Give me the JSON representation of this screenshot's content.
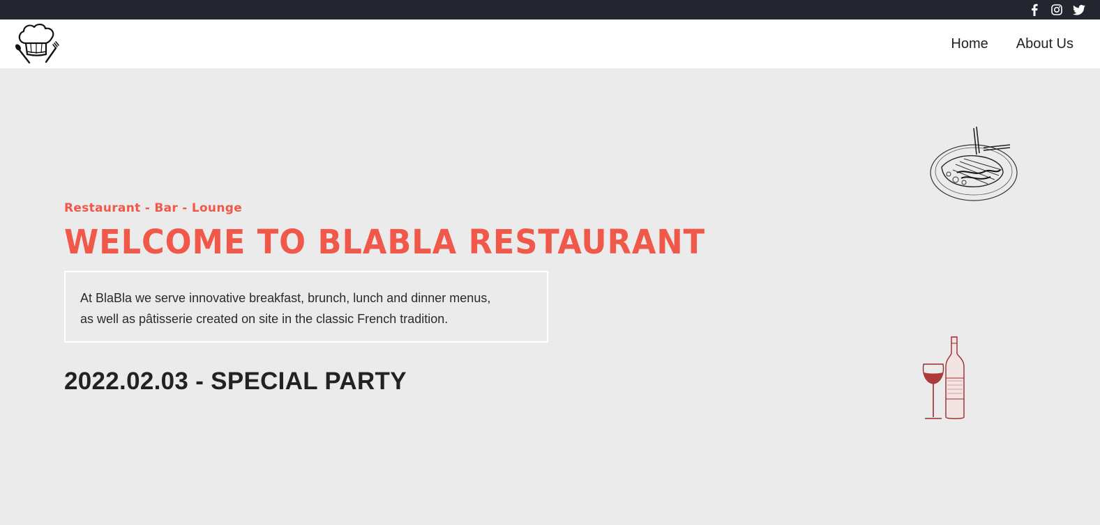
{
  "topbar": {
    "social": [
      {
        "icon": "facebook-icon"
      },
      {
        "icon": "instagram-icon"
      },
      {
        "icon": "twitter-icon"
      }
    ]
  },
  "navbar": {
    "logo_icon": "chef-hat-logo",
    "nav": [
      {
        "label": "Home"
      },
      {
        "label": "About Us"
      }
    ]
  },
  "hero": {
    "subtitle": "Restaurant - Bar - Lounge",
    "title": "WELCOME TO BLABLA RESTAURANT",
    "description_line1": "At BlaBla we serve innovative breakfast, brunch, lunch and dinner menus,",
    "description_line2": "as well as pâtisserie created on site in the classic French tradition.",
    "event": "2022.02.03 - SPECIAL PARTY"
  },
  "illustrations": {
    "plate_icon": "steak-plate-illustration",
    "wine_icon": "wine-bottle-glass-illustration"
  },
  "colors": {
    "accent": "#f0584a",
    "topbar": "#23262f",
    "background": "#ebebeb",
    "wine": "#9b2a2a"
  }
}
